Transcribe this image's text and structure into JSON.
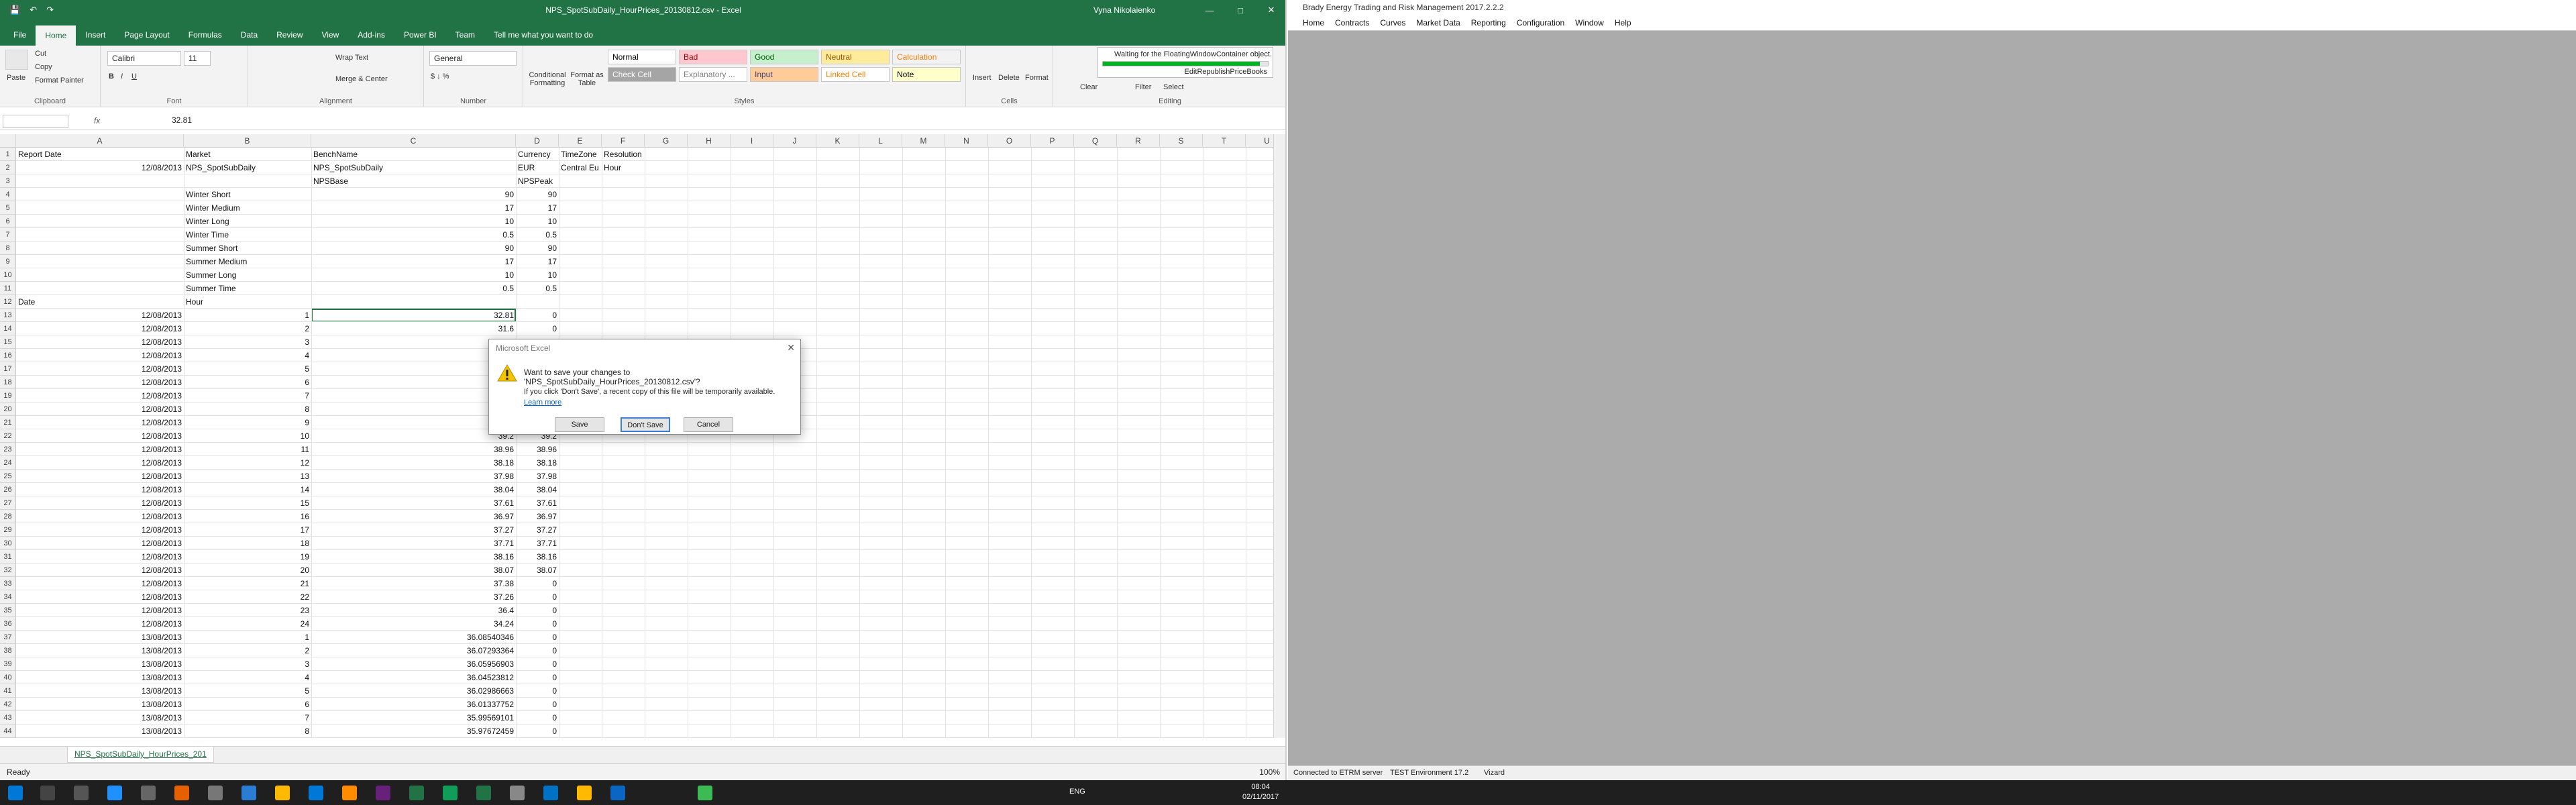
{
  "excel": {
    "title": "NPS_SpotSubDaily_HourPrices_20130812.csv - Excel",
    "user": "Vyna Nikolaienko",
    "tabs": [
      "File",
      "Home",
      "Insert",
      "Page Layout",
      "Formulas",
      "Data",
      "Review",
      "View",
      "Add-ins",
      "Power BI",
      "Team"
    ],
    "tell_me": "Tell me what you want to do",
    "ribbon": {
      "paste": "Paste",
      "cut": "Cut",
      "copy": "Copy",
      "format_painter": "Format Painter",
      "clipboard": "Clipboard",
      "font_name": "Calibri",
      "font_size": "11",
      "font": "Font",
      "wrap_text": "Wrap Text",
      "merge_center": "Merge & Center",
      "alignment": "Alignment",
      "number_format": "General",
      "number": "Number",
      "conditional_formatting": "Conditional Formatting",
      "format_as_table": "Format as Table",
      "styles_label": "Styles",
      "styles": [
        {
          "label": "Normal",
          "bg": "#ffffff",
          "fg": "#000000"
        },
        {
          "label": "Bad",
          "bg": "#ffc7ce",
          "fg": "#9c0006"
        },
        {
          "label": "Good",
          "bg": "#c6efce",
          "fg": "#006100"
        },
        {
          "label": "Neutral",
          "bg": "#ffeb9c",
          "fg": "#9c5700"
        },
        {
          "label": "Calculation",
          "bg": "#f2f2f2",
          "fg": "#fa7d00"
        },
        {
          "label": "Check Cell",
          "bg": "#a5a5a5",
          "fg": "#ffffff"
        },
        {
          "label": "Explanatory ...",
          "bg": "#ffffff",
          "fg": "#7f7f7f"
        },
        {
          "label": "Input",
          "bg": "#ffcc99",
          "fg": "#3f3f76"
        },
        {
          "label": "Linked Cell",
          "bg": "#ffffff",
          "fg": "#fa7d00"
        },
        {
          "label": "Note",
          "bg": "#ffffcc",
          "fg": "#000000"
        }
      ],
      "insert": "Insert",
      "delete": "Delete",
      "format": "Format",
      "cells": "Cells",
      "clear": "Clear",
      "filter": "Filter",
      "select": "Select",
      "editing": "Editing"
    },
    "name_box": "",
    "formula_value": "32.81",
    "columns": [
      "A",
      "B",
      "C",
      "D",
      "E",
      "F",
      "G",
      "H",
      "I",
      "J",
      "K",
      "L",
      "M",
      "N",
      "O",
      "P",
      "Q",
      "R",
      "S",
      "T",
      "U"
    ],
    "rows": [
      [
        "Report Date",
        "Market",
        "BenchName",
        "Currency",
        "TimeZone",
        "Resolution"
      ],
      [
        "12/08/2013",
        "NPS_SpotSubDaily",
        "NPS_SpotSubDaily",
        "EUR",
        "Central Eu",
        "Hour"
      ],
      [
        "",
        "",
        "NPSBase",
        "NPSPeak",
        "",
        ""
      ],
      [
        "",
        "Winter Short",
        "90",
        "90",
        "",
        ""
      ],
      [
        "",
        "Winter Medium",
        "17",
        "17",
        "",
        ""
      ],
      [
        "",
        "Winter Long",
        "10",
        "10",
        "",
        ""
      ],
      [
        "",
        "Winter Time",
        "0.5",
        "0.5",
        "",
        ""
      ],
      [
        "",
        "Summer Short",
        "90",
        "90",
        "",
        ""
      ],
      [
        "",
        "Summer Medium",
        "17",
        "17",
        "",
        ""
      ],
      [
        "",
        "Summer Long",
        "10",
        "10",
        "",
        ""
      ],
      [
        "",
        "Summer Time",
        "0.5",
        "0.5",
        "",
        ""
      ],
      [
        "Date",
        "Hour",
        "",
        "",
        "",
        ""
      ],
      [
        "12/08/2013",
        "1",
        "32.81",
        "0",
        "",
        ""
      ],
      [
        "12/08/2013",
        "2",
        "31.6",
        "0",
        "",
        ""
      ],
      [
        "12/08/2013",
        "3",
        "",
        "",
        "",
        ""
      ],
      [
        "12/08/2013",
        "4",
        "",
        "",
        "",
        ""
      ],
      [
        "12/08/2013",
        "5",
        "",
        "",
        "",
        ""
      ],
      [
        "12/08/2013",
        "6",
        "",
        "",
        "",
        ""
      ],
      [
        "12/08/2013",
        "7",
        "",
        "",
        "",
        ""
      ],
      [
        "12/08/2013",
        "8",
        "",
        "",
        "",
        ""
      ],
      [
        "12/08/2013",
        "9",
        "",
        "",
        "",
        ""
      ],
      [
        "12/08/2013",
        "10",
        "39.2",
        "39.2",
        "",
        ""
      ],
      [
        "12/08/2013",
        "11",
        "38.96",
        "38.96",
        "",
        ""
      ],
      [
        "12/08/2013",
        "12",
        "38.18",
        "38.18",
        "",
        ""
      ],
      [
        "12/08/2013",
        "13",
        "37.98",
        "37.98",
        "",
        ""
      ],
      [
        "12/08/2013",
        "14",
        "38.04",
        "38.04",
        "",
        ""
      ],
      [
        "12/08/2013",
        "15",
        "37.61",
        "37.61",
        "",
        ""
      ],
      [
        "12/08/2013",
        "16",
        "36.97",
        "36.97",
        "",
        ""
      ],
      [
        "12/08/2013",
        "17",
        "37.27",
        "37.27",
        "",
        ""
      ],
      [
        "12/08/2013",
        "18",
        "37.71",
        "37.71",
        "",
        ""
      ],
      [
        "12/08/2013",
        "19",
        "38.16",
        "38.16",
        "",
        ""
      ],
      [
        "12/08/2013",
        "20",
        "38.07",
        "38.07",
        "",
        ""
      ],
      [
        "12/08/2013",
        "21",
        "37.38",
        "0",
        "",
        ""
      ],
      [
        "12/08/2013",
        "22",
        "37.26",
        "0",
        "",
        ""
      ],
      [
        "12/08/2013",
        "23",
        "36.4",
        "0",
        "",
        ""
      ],
      [
        "12/08/2013",
        "24",
        "34.24",
        "0",
        "",
        ""
      ],
      [
        "13/08/2013",
        "1",
        "36.08540346",
        "0",
        "",
        ""
      ],
      [
        "13/08/2013",
        "2",
        "36.07293364",
        "0",
        "",
        ""
      ],
      [
        "13/08/2013",
        "3",
        "36.05956903",
        "0",
        "",
        ""
      ],
      [
        "13/08/2013",
        "4",
        "36.04523812",
        "0",
        "",
        ""
      ],
      [
        "13/08/2013",
        "5",
        "36.02986663",
        "0",
        "",
        ""
      ],
      [
        "13/08/2013",
        "6",
        "36.01337752",
        "0",
        "",
        ""
      ],
      [
        "13/08/2013",
        "7",
        "35.99569101",
        "0",
        "",
        ""
      ],
      [
        "13/08/2013",
        "8",
        "35.97672459",
        "0",
        "",
        ""
      ]
    ],
    "sheet_tab": "NPS_SpotSubDaily_HourPrices_201",
    "status": "Ready",
    "zoom": "100%"
  },
  "dialog": {
    "title": "Microsoft Excel",
    "message": "Want to save your changes to 'NPS_SpotSubDaily_HourPrices_20130812.csv'?",
    "sub": "If you click 'Don't Save', a recent copy of this file will be temporarily available.",
    "learn_more": "Learn more",
    "save": "Save",
    "dont_save": "Don't Save",
    "cancel": "Cancel"
  },
  "waiting": {
    "text": "Waiting for the FloatingWindowContainer object.",
    "progress": 0.95,
    "sub": "EditRepublishPriceBooks"
  },
  "etrm": {
    "title": "Brady Energy Trading and Risk Management 2017.2.2.2",
    "menu": [
      "Home",
      "Contracts",
      "Curves",
      "Market Data",
      "Reporting",
      "Configuration",
      "Window",
      "Help"
    ],
    "status_server": "Connected to ETRM server",
    "status_env": "TEST Environment 17.2",
    "status_user": "Vizard"
  },
  "taskbar": {
    "lang": "ENG",
    "time": "08:04",
    "date": "02/11/2017"
  }
}
